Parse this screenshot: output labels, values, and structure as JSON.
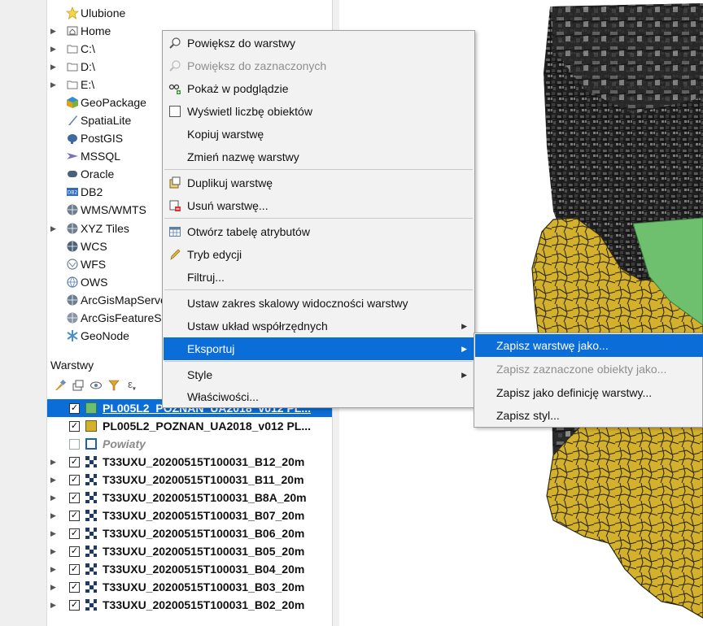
{
  "browser": {
    "items": [
      {
        "label": "Ulubione",
        "icon": "star-icon",
        "expandable": false
      },
      {
        "label": "Home",
        "icon": "home-folder-icon",
        "expandable": true
      },
      {
        "label": "C:\\",
        "icon": "folder-icon",
        "expandable": true
      },
      {
        "label": "D:\\",
        "icon": "folder-icon",
        "expandable": true
      },
      {
        "label": "E:\\",
        "icon": "folder-icon",
        "expandable": true
      },
      {
        "label": "GeoPackage",
        "icon": "geopackage-icon",
        "expandable": false
      },
      {
        "label": "SpatiaLite",
        "icon": "spatialite-icon",
        "expandable": false
      },
      {
        "label": "PostGIS",
        "icon": "postgis-icon",
        "expandable": false
      },
      {
        "label": "MSSQL",
        "icon": "mssql-icon",
        "expandable": false
      },
      {
        "label": "Oracle",
        "icon": "oracle-icon",
        "expandable": false
      },
      {
        "label": "DB2",
        "icon": "db2-icon",
        "expandable": false
      },
      {
        "label": "WMS/WMTS",
        "icon": "globe-icon",
        "expandable": false
      },
      {
        "label": "XYZ Tiles",
        "icon": "globe-icon",
        "expandable": true
      },
      {
        "label": "WCS",
        "icon": "globe-icon",
        "expandable": false
      },
      {
        "label": "WFS",
        "icon": "globe-icon",
        "expandable": false
      },
      {
        "label": "OWS",
        "icon": "globe-icon",
        "expandable": false
      },
      {
        "label": "ArcGisMapServer",
        "icon": "globe-icon",
        "expandable": false
      },
      {
        "label": "ArcGisFeatureServer",
        "icon": "globe-icon",
        "expandable": false
      },
      {
        "label": "GeoNode",
        "icon": "geonode-icon",
        "expandable": false
      }
    ]
  },
  "layers": {
    "title": "Warstwy",
    "items": [
      {
        "name": "PL005L2_POZNAN_UA2018_v012 PL...",
        "checked": true,
        "symbol": "fill-green",
        "selected": true,
        "expandable": false
      },
      {
        "name": "PL005L2_POZNAN_UA2018_v012 PL...",
        "checked": true,
        "symbol": "fill-yellow",
        "selected": false,
        "expandable": false
      },
      {
        "name": "Powiaty",
        "checked": false,
        "symbol": "outline-blue",
        "selected": false,
        "expandable": false,
        "italic": true
      },
      {
        "name": "T33UXU_20200515T100031_B12_20m",
        "checked": true,
        "symbol": "raster",
        "selected": false,
        "expandable": true
      },
      {
        "name": "T33UXU_20200515T100031_B11_20m",
        "checked": true,
        "symbol": "raster",
        "selected": false,
        "expandable": true
      },
      {
        "name": "T33UXU_20200515T100031_B8A_20m",
        "checked": true,
        "symbol": "raster",
        "selected": false,
        "expandable": true
      },
      {
        "name": "T33UXU_20200515T100031_B07_20m",
        "checked": true,
        "symbol": "raster",
        "selected": false,
        "expandable": true
      },
      {
        "name": "T33UXU_20200515T100031_B06_20m",
        "checked": true,
        "symbol": "raster",
        "selected": false,
        "expandable": true
      },
      {
        "name": "T33UXU_20200515T100031_B05_20m",
        "checked": true,
        "symbol": "raster",
        "selected": false,
        "expandable": true
      },
      {
        "name": "T33UXU_20200515T100031_B04_20m",
        "checked": true,
        "symbol": "raster",
        "selected": false,
        "expandable": true
      },
      {
        "name": "T33UXU_20200515T100031_B03_20m",
        "checked": true,
        "symbol": "raster",
        "selected": false,
        "expandable": true
      },
      {
        "name": "T33UXU_20200515T100031_B02_20m",
        "checked": true,
        "symbol": "raster",
        "selected": false,
        "expandable": true
      }
    ]
  },
  "context_menu": {
    "items": [
      {
        "label": "Powiększ do warstwy",
        "icon": "zoom-layer-icon"
      },
      {
        "label": "Powiększ do zaznaczonych",
        "icon": "zoom-selected-icon",
        "disabled": true
      },
      {
        "label": "Pokaż w podglądzie",
        "icon": "overview-icon"
      },
      {
        "label": "Wyświetl liczbę obiektów",
        "icon": "checkbox-icon"
      },
      {
        "label": "Kopiuj warstwę",
        "icon": ""
      },
      {
        "label": "Zmień nazwę warstwy",
        "icon": ""
      },
      {
        "label": "Duplikuj warstwę",
        "icon": "duplicate-layer-icon"
      },
      {
        "label": "Usuń warstwę...",
        "icon": "remove-layer-icon"
      },
      {
        "label": "Otwórz tabelę atrybutów",
        "icon": "attribute-table-icon"
      },
      {
        "label": "Tryb edycji",
        "icon": "pencil-icon"
      },
      {
        "label": "Filtruj...",
        "icon": ""
      },
      {
        "label": "Ustaw zakres skalowy widoczności warstwy",
        "icon": ""
      },
      {
        "label": "Ustaw układ współrzędnych",
        "icon": "",
        "submenu": true
      },
      {
        "label": "Eksportuj",
        "icon": "",
        "submenu": true,
        "highlighted": true
      },
      {
        "label": "Style",
        "icon": "",
        "submenu": true
      },
      {
        "label": "Właściwości...",
        "icon": ""
      }
    ]
  },
  "export_submenu": {
    "items": [
      {
        "label": "Zapisz warstwę jako...",
        "highlighted": true
      },
      {
        "label": "Zapisz zaznaczone obiekty jako...",
        "disabled": true
      },
      {
        "label": "Zapisz jako definicję warstwy..."
      },
      {
        "label": "Zapisz styl..."
      }
    ]
  },
  "colors": {
    "highlight": "#0a6dd8",
    "map_yellow": "#d4b12c",
    "map_green": "#6ec06e",
    "raster_dark": "#2a2a2a"
  }
}
